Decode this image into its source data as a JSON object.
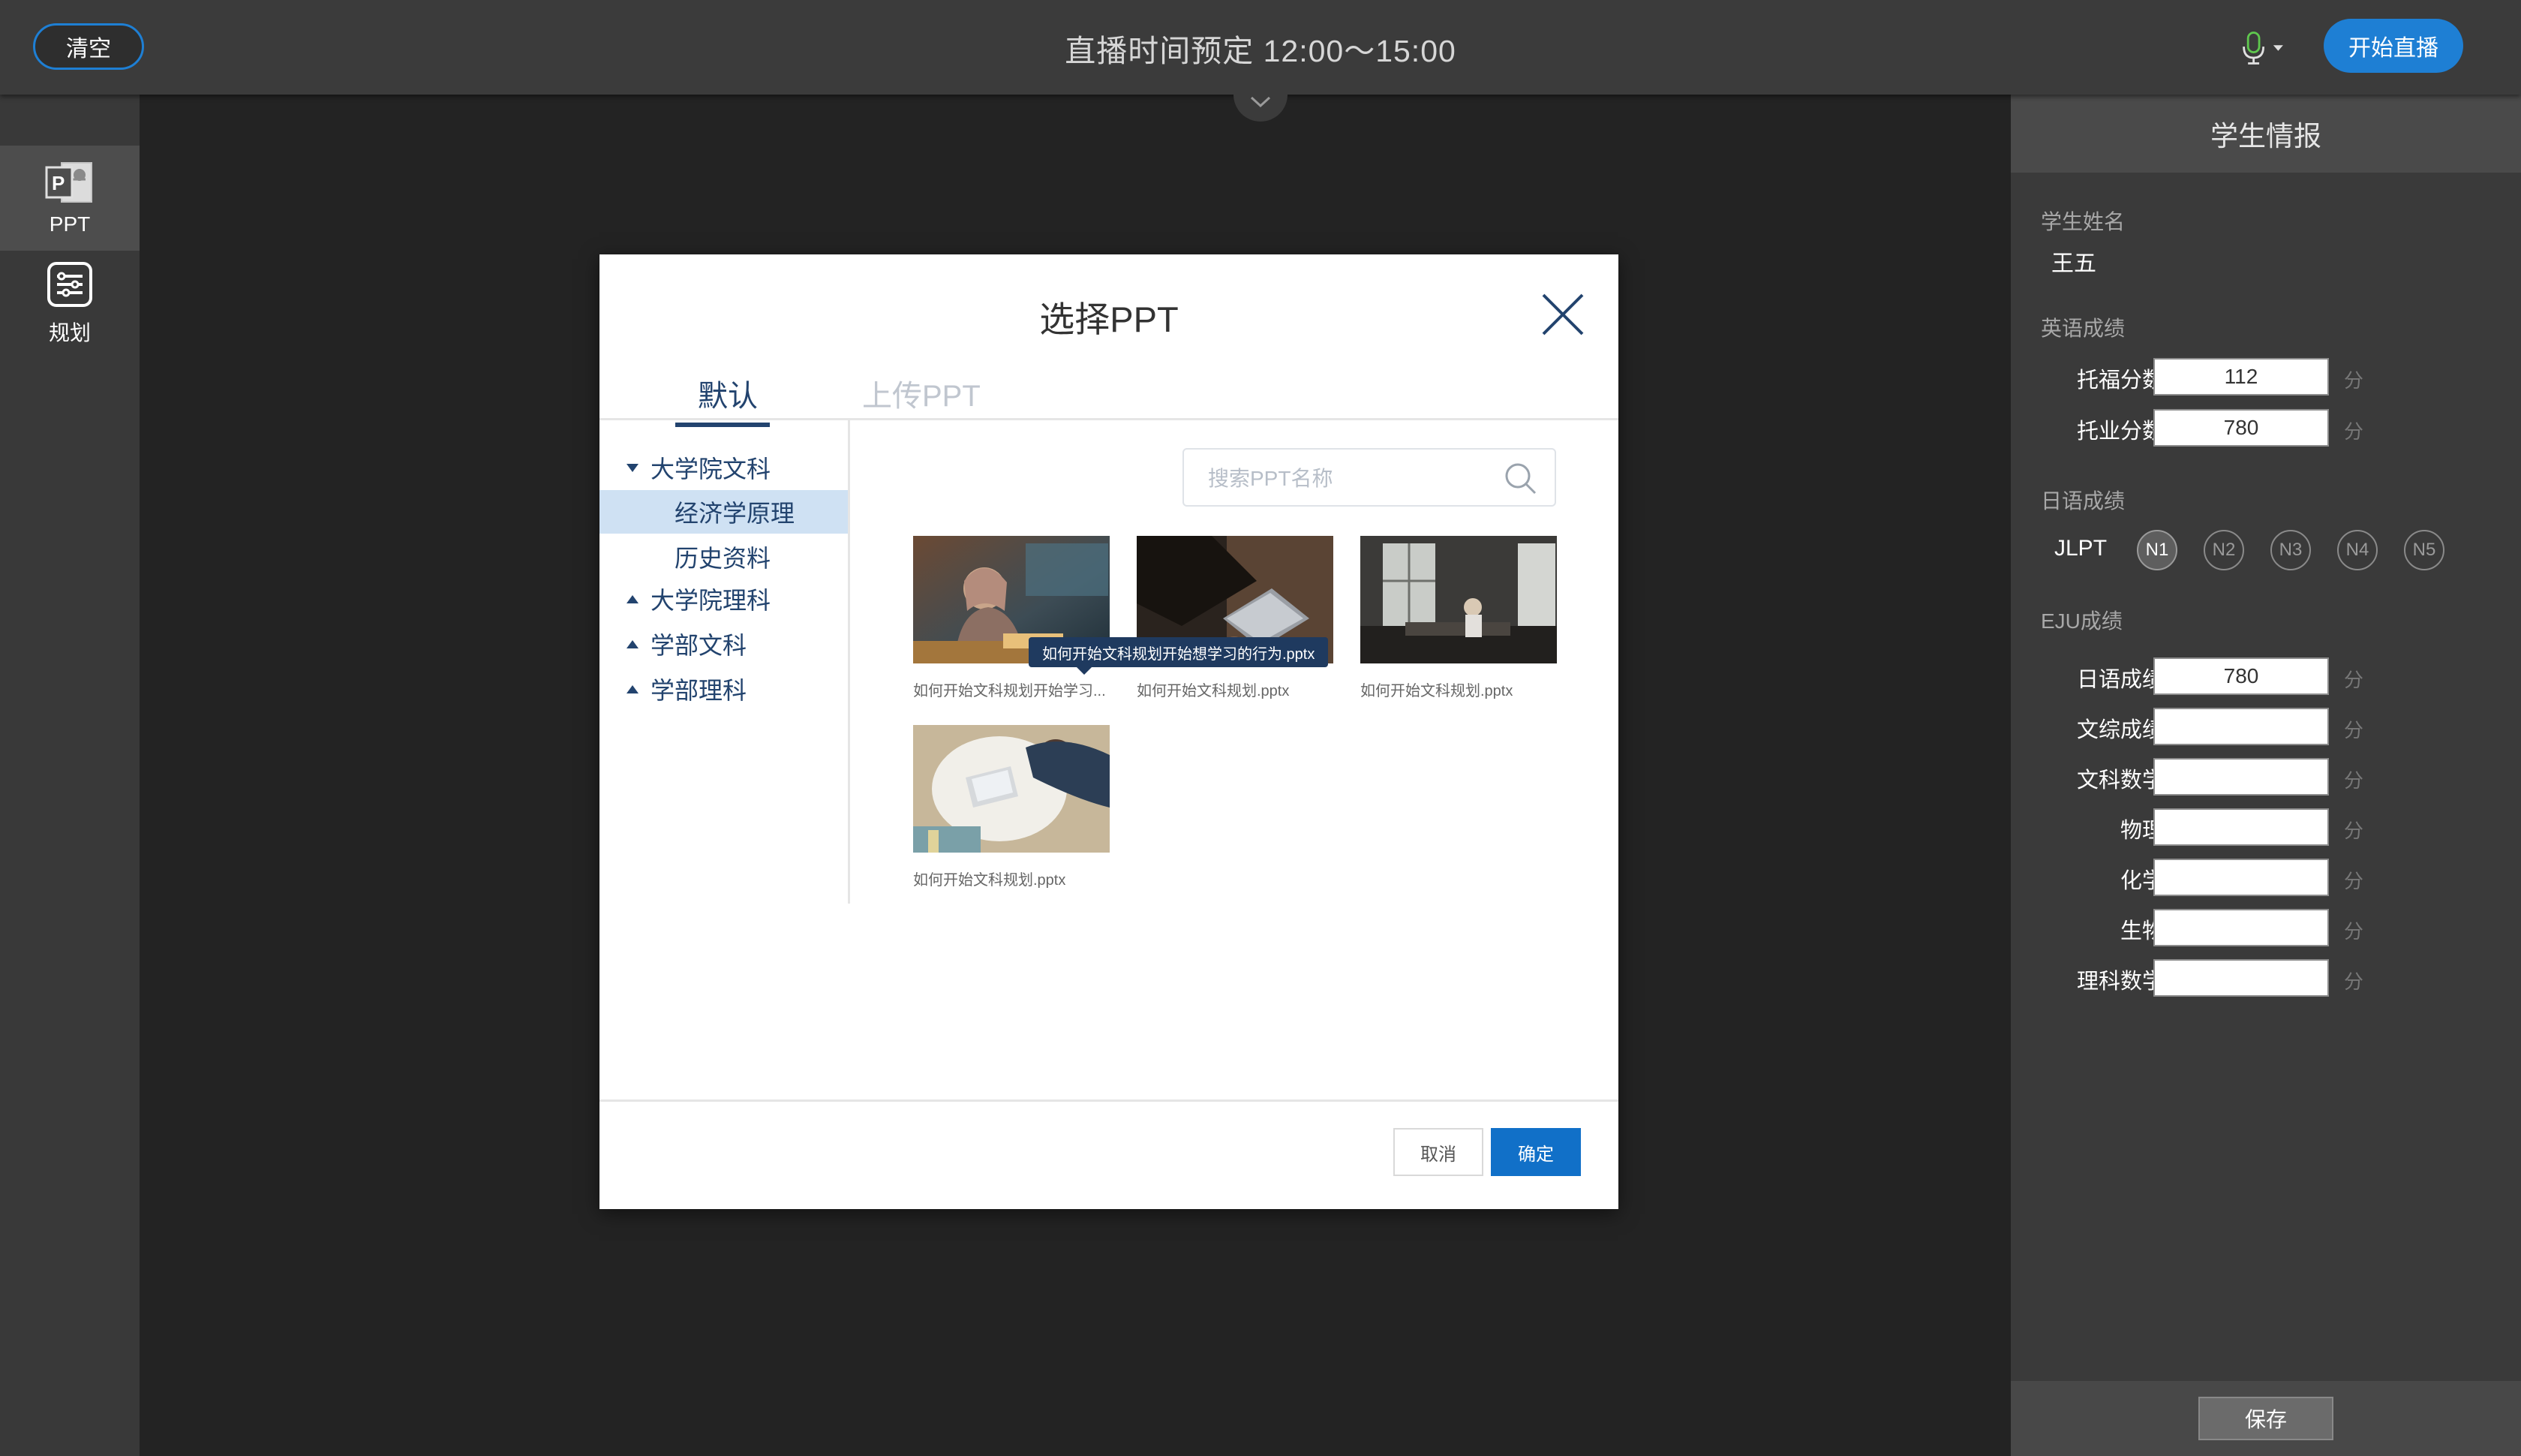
{
  "topbar": {
    "clear_label": "清空",
    "title": "直播时间预定 12:00～15:00",
    "start_live_label": "开始直播"
  },
  "sidebar": {
    "items": [
      {
        "label": "PPT",
        "icon": "ppt-icon",
        "active": true
      },
      {
        "label": "规划",
        "icon": "plan-list-icon",
        "active": false
      }
    ]
  },
  "student_panel": {
    "title": "学生情报",
    "name_label": "学生姓名",
    "name_value": "王五",
    "english_section": "英语成绩",
    "toefl_label": "托福分数",
    "toefl_value": "112",
    "toeic_label": "托业分数",
    "toeic_value": "780",
    "japanese_section": "日语成绩",
    "jlpt_label": "JLPT",
    "jlpt_levels": [
      "N1",
      "N2",
      "N3",
      "N4",
      "N5"
    ],
    "jlpt_selected": "N1",
    "eju_section": "EJU成绩",
    "eju_fields": [
      {
        "label": "日语成绩",
        "value": "780"
      },
      {
        "label": "文综成绩",
        "value": ""
      },
      {
        "label": "文科数学",
        "value": ""
      },
      {
        "label": "物理",
        "value": ""
      },
      {
        "label": "化学",
        "value": ""
      },
      {
        "label": "生物",
        "value": ""
      },
      {
        "label": "理科数学",
        "value": ""
      }
    ],
    "unit": "分",
    "save_label": "保存"
  },
  "dialog": {
    "title": "选择PPT",
    "tabs": [
      {
        "label": "默认",
        "active": true
      },
      {
        "label": "上传PPT",
        "active": false
      }
    ],
    "tree": [
      {
        "label": "大学院文科",
        "expanded": true
      },
      {
        "label": "经济学原理",
        "selected": true
      },
      {
        "label": "历史资料"
      },
      {
        "label": "大学院理科",
        "expanded": false
      },
      {
        "label": "学部文科",
        "expanded": false
      },
      {
        "label": "学部理科",
        "expanded": false
      }
    ],
    "search_placeholder": "搜索PPT名称",
    "files": [
      {
        "caption": "如何开始文科规划开始学习..."
      },
      {
        "caption": "如何开始文科规划.pptx"
      },
      {
        "caption": "如何开始文科规划.pptx"
      },
      {
        "caption": "如何开始文科规划.pptx"
      }
    ],
    "tooltip": "如何开始文科规划开始想学习的行为.pptx",
    "cancel_label": "取消",
    "ok_label": "确定"
  },
  "colors": {
    "accent": "#1e7fd4",
    "dialog_text": "#22436e",
    "selection": "#cfe1f3"
  }
}
